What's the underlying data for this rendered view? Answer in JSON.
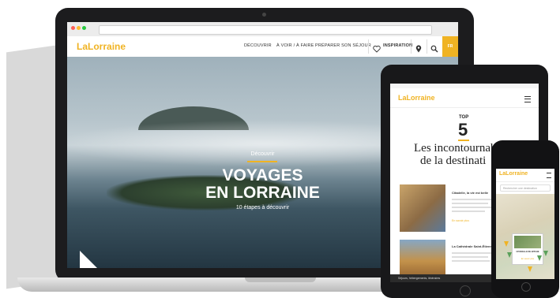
{
  "colors": {
    "brand": "#f0b323",
    "dark_device": "#1c1c1e"
  },
  "desktop": {
    "brand": {
      "prefix": "La",
      "name": "Lorraine"
    },
    "nav": {
      "decouvrir": "DÉCOUVRIR",
      "voir_faire": "À VOIR / À FAIRE",
      "preparer": "PRÉPARER SON SÉJOUR",
      "inspiration": "INSPIRATION",
      "lang": "FR"
    },
    "icons": {
      "heart": "heart-icon",
      "pin": "map-pin-icon",
      "search": "search-icon"
    },
    "hero": {
      "kicker": "Découvrir",
      "title_line1": "VOYAGES",
      "title_line2": "EN LORRAINE",
      "subtitle": "10 étapes à découvrir"
    }
  },
  "tablet": {
    "brand": {
      "prefix": "La",
      "name": "Lorraine"
    },
    "top_label": "TOP",
    "top_number": "5",
    "heading_line1": "Les incontournables",
    "heading_line2": "de la destinati",
    "card1_title": "Citadelle, la vie est belle",
    "card1_link": "En savoir plus",
    "card2_title": "La Cathédrale Saint-Étienne",
    "footer": "Séjours, hébergements, itinéraires"
  },
  "phone": {
    "brand": {
      "prefix": "La",
      "name": "Lorraine"
    },
    "search_placeholder": "Rechercher une destination",
    "map_card_title": "CITADELLE DE BITCHE",
    "map_card_link": "En savoir plus"
  }
}
